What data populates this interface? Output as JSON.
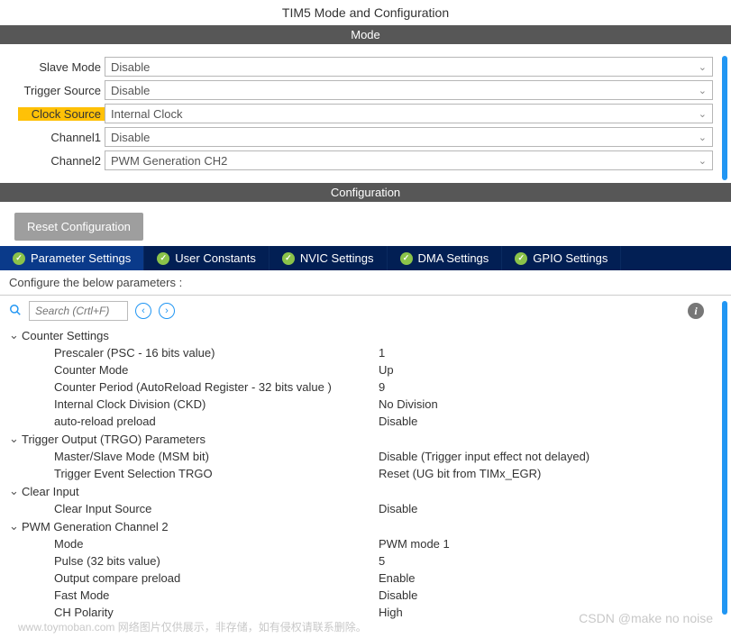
{
  "title": "TIM5 Mode and Configuration",
  "mode_section": {
    "header": "Mode",
    "rows": [
      {
        "label": "Slave Mode",
        "value": "Disable",
        "highlight": false
      },
      {
        "label": "Trigger Source",
        "value": "Disable",
        "highlight": false
      },
      {
        "label": "Clock Source",
        "value": "Internal Clock",
        "highlight": true
      },
      {
        "label": "Channel1",
        "value": "Disable",
        "highlight": false
      },
      {
        "label": "Channel2",
        "value": "PWM Generation CH2",
        "highlight": false
      }
    ]
  },
  "config_section": {
    "header": "Configuration",
    "reset_label": "Reset Configuration",
    "tabs": [
      {
        "label": "Parameter Settings",
        "active": true
      },
      {
        "label": "User Constants",
        "active": false
      },
      {
        "label": "NVIC Settings",
        "active": false
      },
      {
        "label": "DMA Settings",
        "active": false
      },
      {
        "label": "GPIO Settings",
        "active": false
      }
    ],
    "instruction": "Configure the below parameters :",
    "search_placeholder": "Search (Crtl+F)",
    "groups": [
      {
        "name": "Counter Settings",
        "params": [
          {
            "label": "Prescaler (PSC - 16 bits value)",
            "value": "1"
          },
          {
            "label": "Counter Mode",
            "value": "Up"
          },
          {
            "label": "Counter Period (AutoReload Register - 32 bits value )",
            "value": "9"
          },
          {
            "label": "Internal Clock Division (CKD)",
            "value": "No Division"
          },
          {
            "label": "auto-reload preload",
            "value": "Disable"
          }
        ]
      },
      {
        "name": "Trigger Output (TRGO) Parameters",
        "params": [
          {
            "label": "Master/Slave Mode (MSM bit)",
            "value": "Disable (Trigger input effect not delayed)"
          },
          {
            "label": "Trigger Event Selection TRGO",
            "value": "Reset (UG bit from TIMx_EGR)"
          }
        ]
      },
      {
        "name": "Clear Input",
        "params": [
          {
            "label": "Clear Input Source",
            "value": "Disable"
          }
        ]
      },
      {
        "name": "PWM Generation Channel 2",
        "params": [
          {
            "label": "Mode",
            "value": "PWM mode 1"
          },
          {
            "label": "Pulse (32 bits value)",
            "value": "5"
          },
          {
            "label": "Output compare preload",
            "value": "Enable"
          },
          {
            "label": "Fast Mode",
            "value": "Disable"
          },
          {
            "label": "CH Polarity",
            "value": "High"
          }
        ]
      }
    ]
  },
  "watermark_left": "www.toymoban.com 网络图片仅供展示，非存储，如有侵权请联系删除。",
  "watermark_right": "CSDN @make no noise"
}
